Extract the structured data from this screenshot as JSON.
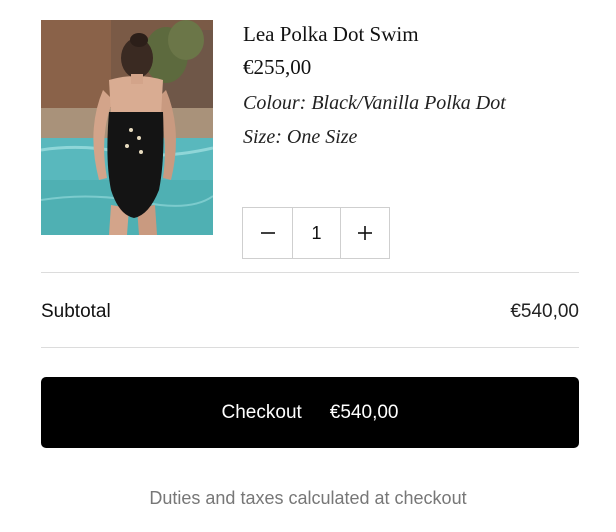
{
  "product": {
    "title": "Lea Polka Dot Swim",
    "price": "€255,00",
    "colour": "Colour: Black/Vanilla Polka Dot",
    "size": "Size: One Size",
    "image_alt": "Woman in black one-piece swimsuit by a pool"
  },
  "quantity": {
    "decrease_icon": "minus-icon",
    "value": "1",
    "increase_icon": "plus-icon"
  },
  "summary": {
    "subtotal_label": "Subtotal",
    "subtotal_value": "€540,00"
  },
  "checkout": {
    "label": "Checkout",
    "amount": "€540,00"
  },
  "note": "Duties and taxes calculated at checkout",
  "colors": {
    "button_bg": "#000000",
    "button_text": "#ffffff",
    "divider": "#dcdcdc",
    "muted_text": "#777777"
  }
}
